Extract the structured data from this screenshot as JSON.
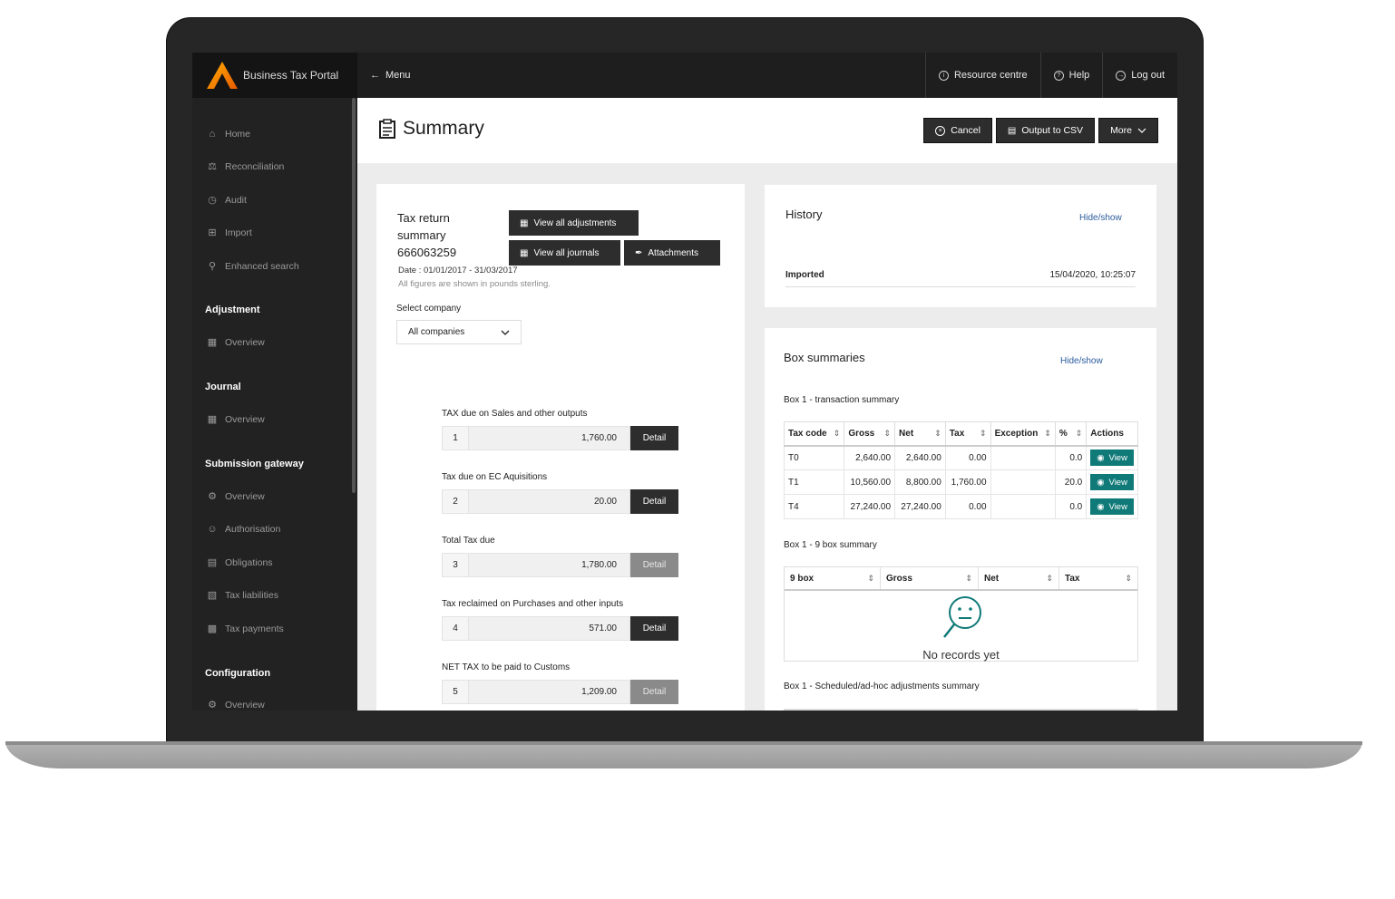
{
  "app": {
    "name": "Business Tax Portal"
  },
  "topbar": {
    "menu_label": "Menu",
    "resource_label": "Resource centre",
    "help_label": "Help",
    "logout_label": "Log out"
  },
  "sidebar": {
    "items": [
      {
        "label": "Home",
        "icon": "home-icon"
      },
      {
        "label": "Reconciliation",
        "icon": "scales-icon"
      },
      {
        "label": "Audit",
        "icon": "clock-icon"
      },
      {
        "label": "Import",
        "icon": "import-icon"
      },
      {
        "label": "Enhanced search",
        "icon": "search-icon"
      }
    ],
    "sections": [
      {
        "title": "Adjustment",
        "items": [
          {
            "label": "Overview"
          }
        ]
      },
      {
        "title": "Journal",
        "items": [
          {
            "label": "Overview"
          }
        ]
      },
      {
        "title": "Submission gateway",
        "items": [
          {
            "label": "Overview"
          },
          {
            "label": "Authorisation"
          },
          {
            "label": "Obligations"
          },
          {
            "label": "Tax liabilities"
          },
          {
            "label": "Tax payments"
          }
        ]
      },
      {
        "title": "Configuration",
        "items": [
          {
            "label": "Overview"
          }
        ]
      }
    ]
  },
  "header": {
    "title": "Summary",
    "cancel_label": "Cancel",
    "csv_label": "Output to CSV",
    "more_label": "More"
  },
  "summary": {
    "title_line1": "Tax return",
    "title_line2": "summary",
    "title_line3": "666063259",
    "view_adjustments_label": "View all adjustments",
    "view_journals_label": "View all journals",
    "attachments_label": "Attachments",
    "date": "Date : 01/01/2017 - 31/03/2017",
    "figures_note": "All figures are shown in pounds sterling.",
    "select_label": "Select company",
    "select_value": "All companies",
    "boxes": [
      {
        "label": "TAX due on Sales and other outputs",
        "num": "1",
        "value": "1,760.00",
        "detail": "Detail",
        "enabled": true
      },
      {
        "label": "Tax due on EC Aquisitions",
        "num": "2",
        "value": "20.00",
        "detail": "Detail",
        "enabled": true
      },
      {
        "label": "Total Tax due",
        "num": "3",
        "value": "1,780.00",
        "detail": "Detail",
        "enabled": false
      },
      {
        "label": "Tax reclaimed on Purchases and other inputs",
        "num": "4",
        "value": "571.00",
        "detail": "Detail",
        "enabled": true
      },
      {
        "label": "NET TAX to be paid to Customs",
        "num": "5",
        "value": "1,209.00",
        "detail": "Detail",
        "enabled": false
      }
    ]
  },
  "history": {
    "title": "History",
    "toggle_label": "Hide/show",
    "imported_label": "Imported",
    "imported_value": "15/04/2020, 10:25:07"
  },
  "box_summaries": {
    "title": "Box summaries",
    "toggle_label": "Hide/show",
    "transaction_title": "Box 1 - transaction summary",
    "transaction_headers": [
      "Tax code",
      "Gross",
      "Net",
      "Tax",
      "Exception",
      "%",
      "Actions"
    ],
    "transaction_rows": [
      {
        "code": "T0",
        "gross": "2,640.00",
        "net": "2,640.00",
        "tax": "0.00",
        "exception": "",
        "pct": "0.0",
        "action": "View"
      },
      {
        "code": "T1",
        "gross": "10,560.00",
        "net": "8,800.00",
        "tax": "1,760.00",
        "exception": "",
        "pct": "20.0",
        "action": "View"
      },
      {
        "code": "T4",
        "gross": "27,240.00",
        "net": "27,240.00",
        "tax": "0.00",
        "exception": "",
        "pct": "0.0",
        "action": "View"
      }
    ],
    "nine_box_title": "Box 1 - 9 box summary",
    "nine_box_headers": [
      "9 box",
      "Gross",
      "Net",
      "Tax"
    ],
    "no_records": "No records yet",
    "adhoc_title": "Box 1 - Scheduled/ad-hoc adjustments summary"
  },
  "colors": {
    "accent_orange": "#f07c00",
    "teal": "#0f7a78",
    "link": "#2a5b9c"
  }
}
